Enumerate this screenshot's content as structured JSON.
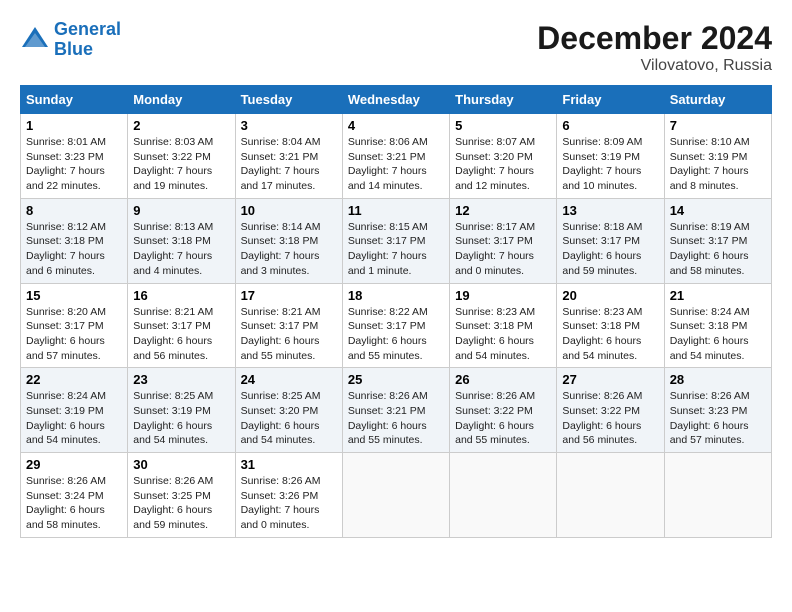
{
  "header": {
    "logo_line1": "General",
    "logo_line2": "Blue",
    "month": "December 2024",
    "location": "Vilovatovo, Russia"
  },
  "weekdays": [
    "Sunday",
    "Monday",
    "Tuesday",
    "Wednesday",
    "Thursday",
    "Friday",
    "Saturday"
  ],
  "weeks": [
    [
      {
        "day": "1",
        "sunrise": "Sunrise: 8:01 AM",
        "sunset": "Sunset: 3:23 PM",
        "daylight": "Daylight: 7 hours and 22 minutes."
      },
      {
        "day": "2",
        "sunrise": "Sunrise: 8:03 AM",
        "sunset": "Sunset: 3:22 PM",
        "daylight": "Daylight: 7 hours and 19 minutes."
      },
      {
        "day": "3",
        "sunrise": "Sunrise: 8:04 AM",
        "sunset": "Sunset: 3:21 PM",
        "daylight": "Daylight: 7 hours and 17 minutes."
      },
      {
        "day": "4",
        "sunrise": "Sunrise: 8:06 AM",
        "sunset": "Sunset: 3:21 PM",
        "daylight": "Daylight: 7 hours and 14 minutes."
      },
      {
        "day": "5",
        "sunrise": "Sunrise: 8:07 AM",
        "sunset": "Sunset: 3:20 PM",
        "daylight": "Daylight: 7 hours and 12 minutes."
      },
      {
        "day": "6",
        "sunrise": "Sunrise: 8:09 AM",
        "sunset": "Sunset: 3:19 PM",
        "daylight": "Daylight: 7 hours and 10 minutes."
      },
      {
        "day": "7",
        "sunrise": "Sunrise: 8:10 AM",
        "sunset": "Sunset: 3:19 PM",
        "daylight": "Daylight: 7 hours and 8 minutes."
      }
    ],
    [
      {
        "day": "8",
        "sunrise": "Sunrise: 8:12 AM",
        "sunset": "Sunset: 3:18 PM",
        "daylight": "Daylight: 7 hours and 6 minutes."
      },
      {
        "day": "9",
        "sunrise": "Sunrise: 8:13 AM",
        "sunset": "Sunset: 3:18 PM",
        "daylight": "Daylight: 7 hours and 4 minutes."
      },
      {
        "day": "10",
        "sunrise": "Sunrise: 8:14 AM",
        "sunset": "Sunset: 3:18 PM",
        "daylight": "Daylight: 7 hours and 3 minutes."
      },
      {
        "day": "11",
        "sunrise": "Sunrise: 8:15 AM",
        "sunset": "Sunset: 3:17 PM",
        "daylight": "Daylight: 7 hours and 1 minute."
      },
      {
        "day": "12",
        "sunrise": "Sunrise: 8:17 AM",
        "sunset": "Sunset: 3:17 PM",
        "daylight": "Daylight: 7 hours and 0 minutes."
      },
      {
        "day": "13",
        "sunrise": "Sunrise: 8:18 AM",
        "sunset": "Sunset: 3:17 PM",
        "daylight": "Daylight: 6 hours and 59 minutes."
      },
      {
        "day": "14",
        "sunrise": "Sunrise: 8:19 AM",
        "sunset": "Sunset: 3:17 PM",
        "daylight": "Daylight: 6 hours and 58 minutes."
      }
    ],
    [
      {
        "day": "15",
        "sunrise": "Sunrise: 8:20 AM",
        "sunset": "Sunset: 3:17 PM",
        "daylight": "Daylight: 6 hours and 57 minutes."
      },
      {
        "day": "16",
        "sunrise": "Sunrise: 8:21 AM",
        "sunset": "Sunset: 3:17 PM",
        "daylight": "Daylight: 6 hours and 56 minutes."
      },
      {
        "day": "17",
        "sunrise": "Sunrise: 8:21 AM",
        "sunset": "Sunset: 3:17 PM",
        "daylight": "Daylight: 6 hours and 55 minutes."
      },
      {
        "day": "18",
        "sunrise": "Sunrise: 8:22 AM",
        "sunset": "Sunset: 3:17 PM",
        "daylight": "Daylight: 6 hours and 55 minutes."
      },
      {
        "day": "19",
        "sunrise": "Sunrise: 8:23 AM",
        "sunset": "Sunset: 3:18 PM",
        "daylight": "Daylight: 6 hours and 54 minutes."
      },
      {
        "day": "20",
        "sunrise": "Sunrise: 8:23 AM",
        "sunset": "Sunset: 3:18 PM",
        "daylight": "Daylight: 6 hours and 54 minutes."
      },
      {
        "day": "21",
        "sunrise": "Sunrise: 8:24 AM",
        "sunset": "Sunset: 3:18 PM",
        "daylight": "Daylight: 6 hours and 54 minutes."
      }
    ],
    [
      {
        "day": "22",
        "sunrise": "Sunrise: 8:24 AM",
        "sunset": "Sunset: 3:19 PM",
        "daylight": "Daylight: 6 hours and 54 minutes."
      },
      {
        "day": "23",
        "sunrise": "Sunrise: 8:25 AM",
        "sunset": "Sunset: 3:19 PM",
        "daylight": "Daylight: 6 hours and 54 minutes."
      },
      {
        "day": "24",
        "sunrise": "Sunrise: 8:25 AM",
        "sunset": "Sunset: 3:20 PM",
        "daylight": "Daylight: 6 hours and 54 minutes."
      },
      {
        "day": "25",
        "sunrise": "Sunrise: 8:26 AM",
        "sunset": "Sunset: 3:21 PM",
        "daylight": "Daylight: 6 hours and 55 minutes."
      },
      {
        "day": "26",
        "sunrise": "Sunrise: 8:26 AM",
        "sunset": "Sunset: 3:22 PM",
        "daylight": "Daylight: 6 hours and 55 minutes."
      },
      {
        "day": "27",
        "sunrise": "Sunrise: 8:26 AM",
        "sunset": "Sunset: 3:22 PM",
        "daylight": "Daylight: 6 hours and 56 minutes."
      },
      {
        "day": "28",
        "sunrise": "Sunrise: 8:26 AM",
        "sunset": "Sunset: 3:23 PM",
        "daylight": "Daylight: 6 hours and 57 minutes."
      }
    ],
    [
      {
        "day": "29",
        "sunrise": "Sunrise: 8:26 AM",
        "sunset": "Sunset: 3:24 PM",
        "daylight": "Daylight: 6 hours and 58 minutes."
      },
      {
        "day": "30",
        "sunrise": "Sunrise: 8:26 AM",
        "sunset": "Sunset: 3:25 PM",
        "daylight": "Daylight: 6 hours and 59 minutes."
      },
      {
        "day": "31",
        "sunrise": "Sunrise: 8:26 AM",
        "sunset": "Sunset: 3:26 PM",
        "daylight": "Daylight: 7 hours and 0 minutes."
      },
      null,
      null,
      null,
      null
    ]
  ]
}
